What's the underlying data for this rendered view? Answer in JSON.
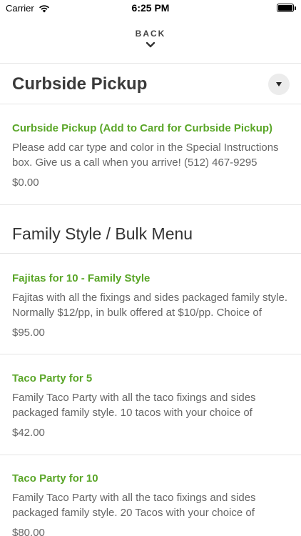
{
  "status_bar": {
    "carrier": "Carrier",
    "time": "6:25 PM",
    "battery_level": 1.0
  },
  "nav": {
    "back_label": "BACK",
    "back_icon": "chevron-down-icon"
  },
  "sections": [
    {
      "title": "Curbside Pickup",
      "has_dropdown": true,
      "dropdown_icon": "triangle-down-icon",
      "items": [
        {
          "name": "Curbside Pickup (Add to Card for Curbside Pickup)",
          "description": "Please add car type and color in the Special Instructions box. Give us a call when you arrive! (512) 467-9295",
          "price": "$0.00"
        }
      ]
    },
    {
      "title": "Family Style / Bulk Menu",
      "items": [
        {
          "name": "Fajitas for 10 - Family Style",
          "description": "Fajitas with all the fixings and sides packaged family style. Normally $12/pp, in bulk offered at $10/pp. Choice of",
          "price": "$95.00"
        },
        {
          "name": "Taco Party for 5",
          "description": "Family Taco Party with all the taco fixings and sides packaged family style. 10 tacos with your choice of",
          "price": "$42.00"
        },
        {
          "name": "Taco Party for 10",
          "description": "Family Taco Party with all the taco fixings and sides packaged family style. 20 Tacos with your choice of",
          "price": "$80.00"
        }
      ]
    }
  ],
  "colors": {
    "item_name": "#5aa628",
    "text": "#666666",
    "heading": "#333333",
    "divider": "#e6e6e6"
  }
}
